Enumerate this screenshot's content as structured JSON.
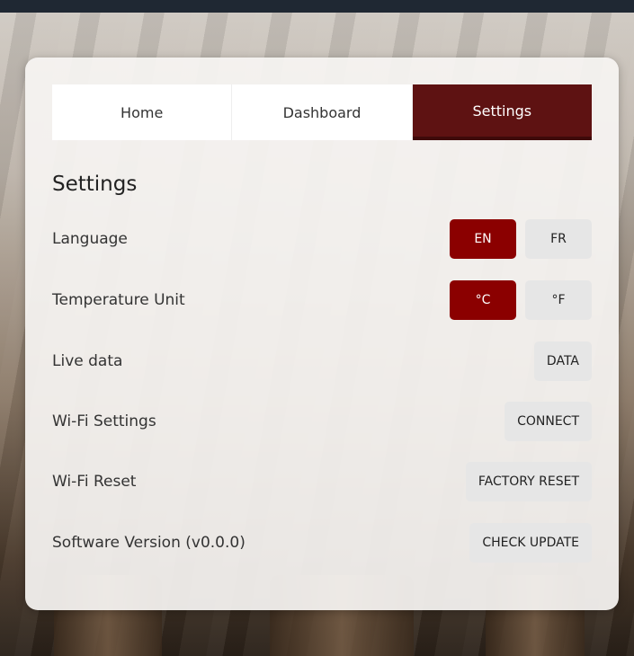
{
  "tabs": [
    {
      "label": "Home"
    },
    {
      "label": "Dashboard"
    },
    {
      "label": "Settings"
    }
  ],
  "section_title": "Settings",
  "rows": {
    "language": {
      "label": "Language",
      "options": [
        "EN",
        "FR"
      ],
      "selected": "EN"
    },
    "temperature": {
      "label": "Temperature Unit",
      "options": [
        "°C",
        "°F"
      ],
      "selected": "°C"
    },
    "live_data": {
      "label": "Live data",
      "button": "DATA"
    },
    "wifi_settings": {
      "label": "Wi-Fi Settings",
      "button": "CONNECT"
    },
    "wifi_reset": {
      "label": "Wi-Fi Reset",
      "button": "FACTORY RESET"
    },
    "software": {
      "label": "Software Version (v0.0.0)",
      "button": "CHECK UPDATE"
    }
  },
  "colors": {
    "accent": "#8b0000",
    "active_tab": "#5e1212"
  }
}
